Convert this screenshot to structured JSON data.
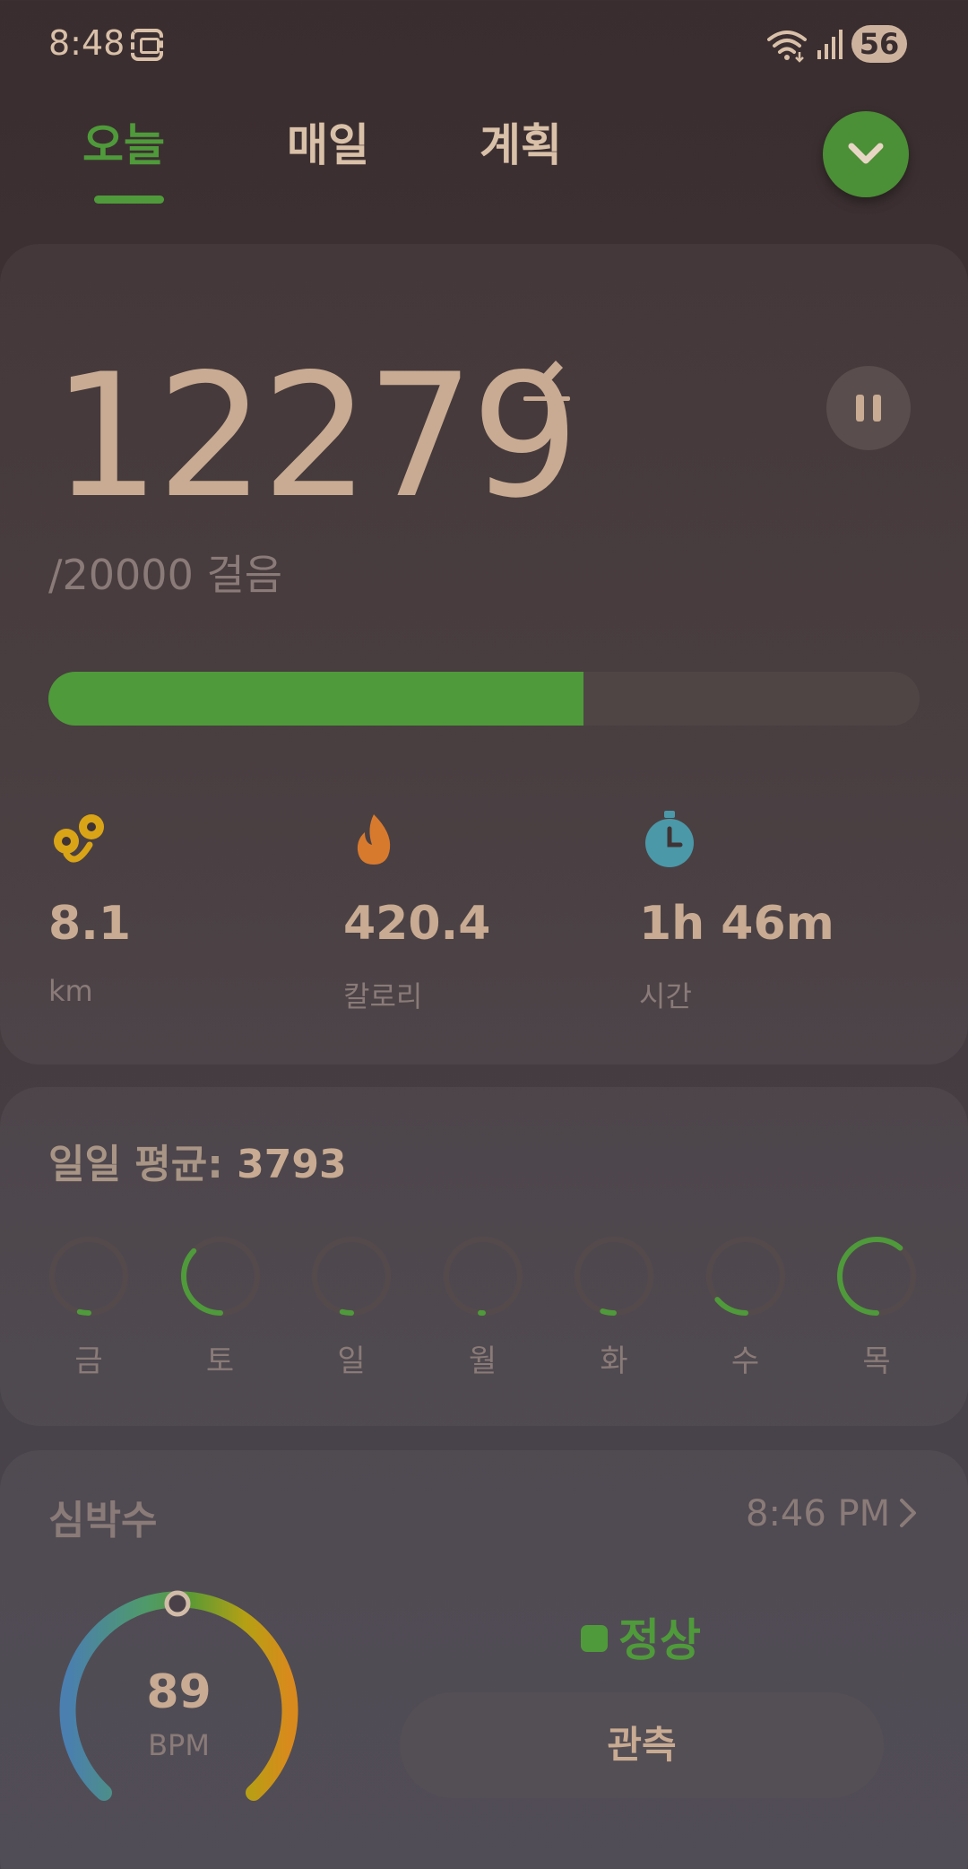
{
  "status_bar": {
    "time": "8:48",
    "battery": "56"
  },
  "tabs": [
    {
      "label": "오늘",
      "active": true
    },
    {
      "label": "매일",
      "active": false
    },
    {
      "label": "계획",
      "active": false
    }
  ],
  "steps": {
    "count": "12279",
    "goal_text": "/20000 걸음",
    "progress": 0.614
  },
  "stats": [
    {
      "icon": "distance-icon",
      "value": "8.1",
      "label": "km",
      "color": "#d9a416"
    },
    {
      "icon": "flame-icon",
      "value": "420.4",
      "label": "칼로리",
      "color": "#d87a2e"
    },
    {
      "icon": "stopwatch-icon",
      "value": "1h 46m",
      "label": "시간",
      "color": "#4b98a8"
    }
  ],
  "daily_average": {
    "title": "일일 평균: ",
    "value": "3793",
    "days": [
      {
        "label": "금",
        "fraction": 0.04
      },
      {
        "label": "토",
        "fraction": 0.37
      },
      {
        "label": "일",
        "fraction": 0.04
      },
      {
        "label": "월",
        "fraction": 0.01
      },
      {
        "label": "화",
        "fraction": 0.05
      },
      {
        "label": "수",
        "fraction": 0.14
      },
      {
        "label": "목",
        "fraction": 0.61
      }
    ]
  },
  "heart_rate": {
    "title": "심박수",
    "time": "8:46 PM",
    "bpm": "89",
    "unit": "BPM",
    "status": "정상",
    "measure_label": "관측"
  },
  "colors": {
    "accent": "#4f9a3a",
    "text": "#c8ab92",
    "muted": "#8a7b78"
  }
}
